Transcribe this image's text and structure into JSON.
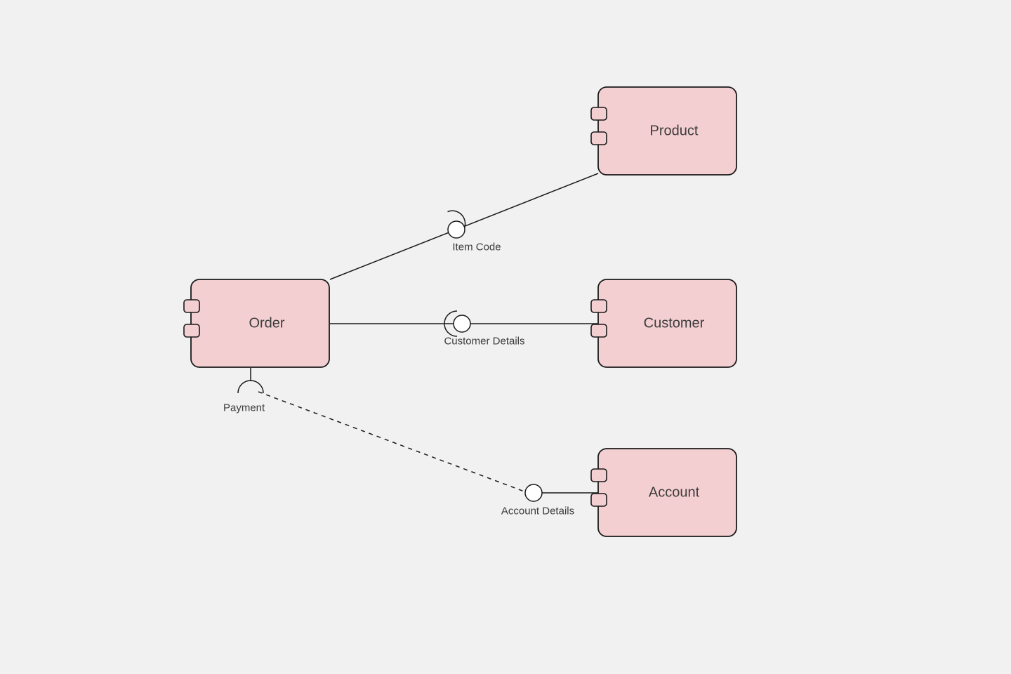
{
  "diagram": {
    "colors": {
      "background": "#f1f1f1",
      "componentFill": "#f4cfd2",
      "componentStroke": "#1a1a1a",
      "textColor": "#3c3c3c",
      "interfaceFill": "#ffffff",
      "interfaceStroke": "#1a1a1a"
    },
    "components": {
      "order": {
        "label": "Order"
      },
      "product": {
        "label": "Product"
      },
      "customer": {
        "label": "Customer"
      },
      "account": {
        "label": "Account"
      }
    },
    "interfaces": {
      "itemCode": {
        "label": "Item Code",
        "kind": "provided"
      },
      "customerDetails": {
        "label": "Customer Details",
        "kind": "provided"
      },
      "payment": {
        "label": "Payment",
        "kind": "required"
      },
      "accountDetails": {
        "label": "Account Details",
        "kind": "provided"
      }
    },
    "connectors": [
      {
        "id": "order-product",
        "from": "order",
        "to": "product",
        "via": "itemCode",
        "style": "solid"
      },
      {
        "id": "order-customer",
        "from": "order",
        "to": "customer",
        "via": "customerDetails",
        "style": "solid"
      },
      {
        "id": "order-account",
        "from": "payment",
        "to": "account",
        "via": "accountDetails",
        "style": "dashed"
      }
    ]
  }
}
